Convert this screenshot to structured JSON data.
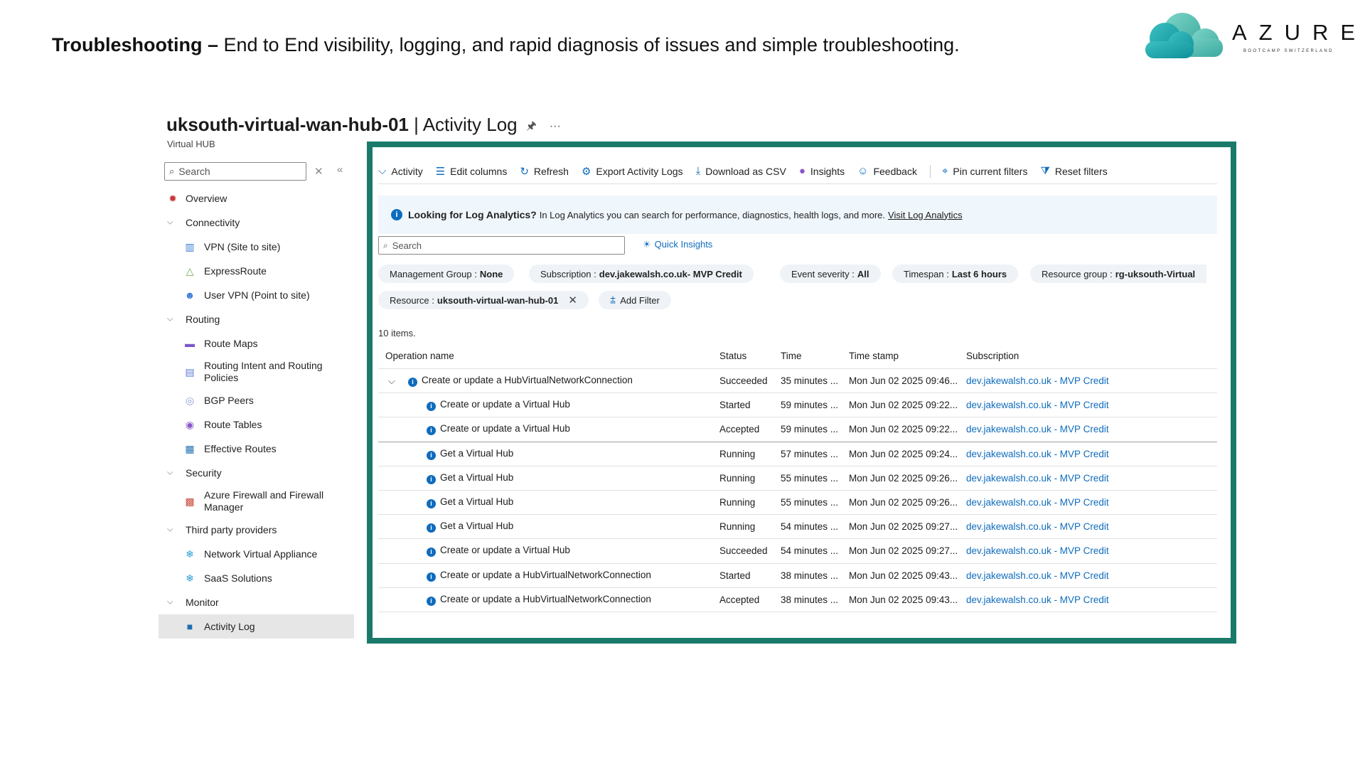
{
  "slide": {
    "title_bold": "Troubleshooting –",
    "title_rest": " End to End visibility, logging, and rapid diagnosis of issues and simple troubleshooting.",
    "logo_word": "AZURE",
    "logo_sub": "BOOTCAMP SWITZERLAND"
  },
  "resource": {
    "name": "uksouth-virtual-wan-hub-01",
    "separator": " | ",
    "page": "Activity Log",
    "type": "Virtual HUB",
    "more": "···"
  },
  "nav": {
    "search_placeholder": "Search",
    "items": [
      {
        "label": "Overview",
        "kind": "group",
        "icon": "overview-icon",
        "glyph": "✹",
        "color": "#c53a3a"
      },
      {
        "label": "Connectivity",
        "kind": "header"
      },
      {
        "label": "VPN (Site to site)",
        "kind": "child",
        "icon": "vpn-icon",
        "glyph": "▥",
        "color": "#3a7bd5"
      },
      {
        "label": "ExpressRoute",
        "kind": "child",
        "icon": "expressroute-icon",
        "glyph": "△",
        "color": "#6aa84f"
      },
      {
        "label": "User VPN (Point to site)",
        "kind": "child",
        "icon": "user-vpn-icon",
        "glyph": "☻",
        "color": "#3a7bd5"
      },
      {
        "label": "Routing",
        "kind": "header"
      },
      {
        "label": "Route Maps",
        "kind": "child",
        "icon": "route-maps-icon",
        "glyph": "▬",
        "color": "#7b56c8"
      },
      {
        "label": "Routing Intent and Routing Policies",
        "kind": "child-double",
        "icon": "routing-intent-icon",
        "glyph": "▤",
        "color": "#5a7bd5"
      },
      {
        "label": "BGP Peers",
        "kind": "child",
        "icon": "bgp-peers-icon",
        "glyph": "◎",
        "color": "#8a9fd5"
      },
      {
        "label": "Route Tables",
        "kind": "child",
        "icon": "route-tables-icon",
        "glyph": "◉",
        "color": "#8a56c8"
      },
      {
        "label": "Effective Routes",
        "kind": "child",
        "icon": "effective-routes-icon",
        "glyph": "▦",
        "color": "#1f6fb5"
      },
      {
        "label": "Security",
        "kind": "header"
      },
      {
        "label": "Azure Firewall and Firewall Manager",
        "kind": "child-double",
        "icon": "firewall-icon",
        "glyph": "▩",
        "color": "#c84a3a"
      },
      {
        "label": "Third party providers",
        "kind": "header"
      },
      {
        "label": "Network Virtual Appliance",
        "kind": "child",
        "icon": "nva-icon",
        "glyph": "❄",
        "color": "#2a9fd5"
      },
      {
        "label": "SaaS Solutions",
        "kind": "child",
        "icon": "saas-icon",
        "glyph": "❄",
        "color": "#2a9fd5"
      },
      {
        "label": "Monitor",
        "kind": "header"
      },
      {
        "label": "Activity Log",
        "kind": "child-selected",
        "icon": "activity-log-icon",
        "glyph": "■",
        "color": "#1f6fb5"
      }
    ]
  },
  "toolbar": {
    "activity": "Activity",
    "edit_columns": "Edit columns",
    "refresh": "Refresh",
    "export": "Export Activity Logs",
    "download": "Download as CSV",
    "insights": "Insights",
    "feedback": "Feedback",
    "pin": "Pin current filters",
    "reset": "Reset filters"
  },
  "info": {
    "heading": "Looking for Log Analytics?",
    "text": "In Log Analytics you can search for performance, diagnostics, health logs, and more.",
    "link": "Visit Log Analytics"
  },
  "log_search": {
    "placeholder": "Search",
    "quick_insights": "Quick Insights"
  },
  "filters": {
    "mg_label": "Management Group :",
    "mg_value": "None",
    "sub_label": "Subscription :",
    "sub_value": "dev.jakewalsh.co.uk",
    "sub_suffix": " - MVP Credit",
    "sev_label": "Event severity :",
    "sev_value": "All",
    "time_label": "Timespan :",
    "time_value": "Last 6 hours",
    "rg_label": "Resource group :",
    "rg_value": "rg-uksouth-Virtual",
    "res_label": "Resource :",
    "res_value": "uksouth-virtual-wan-hub-01",
    "add_filter": "Add Filter"
  },
  "grid": {
    "count": "10 items.",
    "headers": {
      "operation": "Operation name",
      "status": "Status",
      "time": "Time",
      "timestamp": "Time stamp",
      "subscription": "Subscription"
    },
    "rows": [
      {
        "op": "Create or update a HubVirtualNetworkConnection",
        "status": "Succeeded",
        "time": "35 minutes ...",
        "ts": "Mon Jun 02 2025 09:46...",
        "sub": "dev.jakewalsh.co.uk - MVP Credit",
        "parent": true
      },
      {
        "op": "Create or update a Virtual Hub",
        "status": "Started",
        "time": "59 minutes ...",
        "ts": "Mon Jun 02 2025 09:22...",
        "sub": "dev.jakewalsh.co.uk - MVP Credit"
      },
      {
        "op": "Create or update a Virtual Hub",
        "status": "Accepted",
        "time": "59 minutes ...",
        "ts": "Mon Jun 02 2025 09:22...",
        "sub": "dev.jakewalsh.co.uk - MVP Credit",
        "divider": true
      },
      {
        "op": "Get a Virtual Hub",
        "status": "Running",
        "time": "57 minutes ...",
        "ts": "Mon Jun 02 2025 09:24...",
        "sub": "dev.jakewalsh.co.uk - MVP Credit"
      },
      {
        "op": "Get a Virtual Hub",
        "status": "Running",
        "time": "55 minutes ...",
        "ts": "Mon Jun 02 2025 09:26...",
        "sub": "dev.jakewalsh.co.uk - MVP Credit"
      },
      {
        "op": "Get a Virtual Hub",
        "status": "Running",
        "time": "55 minutes ...",
        "ts": "Mon Jun 02 2025 09:26...",
        "sub": "dev.jakewalsh.co.uk - MVP Credit"
      },
      {
        "op": "Get a Virtual Hub",
        "status": "Running",
        "time": "54 minutes ...",
        "ts": "Mon Jun 02 2025 09:27...",
        "sub": "dev.jakewalsh.co.uk - MVP Credit"
      },
      {
        "op": "Create or update a Virtual Hub",
        "status": "Succeeded",
        "time": "54 minutes ...",
        "ts": "Mon Jun 02 2025 09:27...",
        "sub": "dev.jakewalsh.co.uk - MVP Credit"
      },
      {
        "op": "Create or update a HubVirtualNetworkConnection",
        "status": "Started",
        "time": "38 minutes ...",
        "ts": "Mon Jun 02 2025 09:43...",
        "sub": "dev.jakewalsh.co.uk - MVP Credit"
      },
      {
        "op": "Create or update a HubVirtualNetworkConnection",
        "status": "Accepted",
        "time": "38 minutes ...",
        "ts": "Mon Jun 02 2025 09:43...",
        "sub": "dev.jakewalsh.co.uk - MVP Credit"
      }
    ]
  },
  "colors": {
    "accent": "#0f6cbd",
    "panel_border": "#1a7a6a",
    "logo_teal": "#1aa6a6"
  }
}
